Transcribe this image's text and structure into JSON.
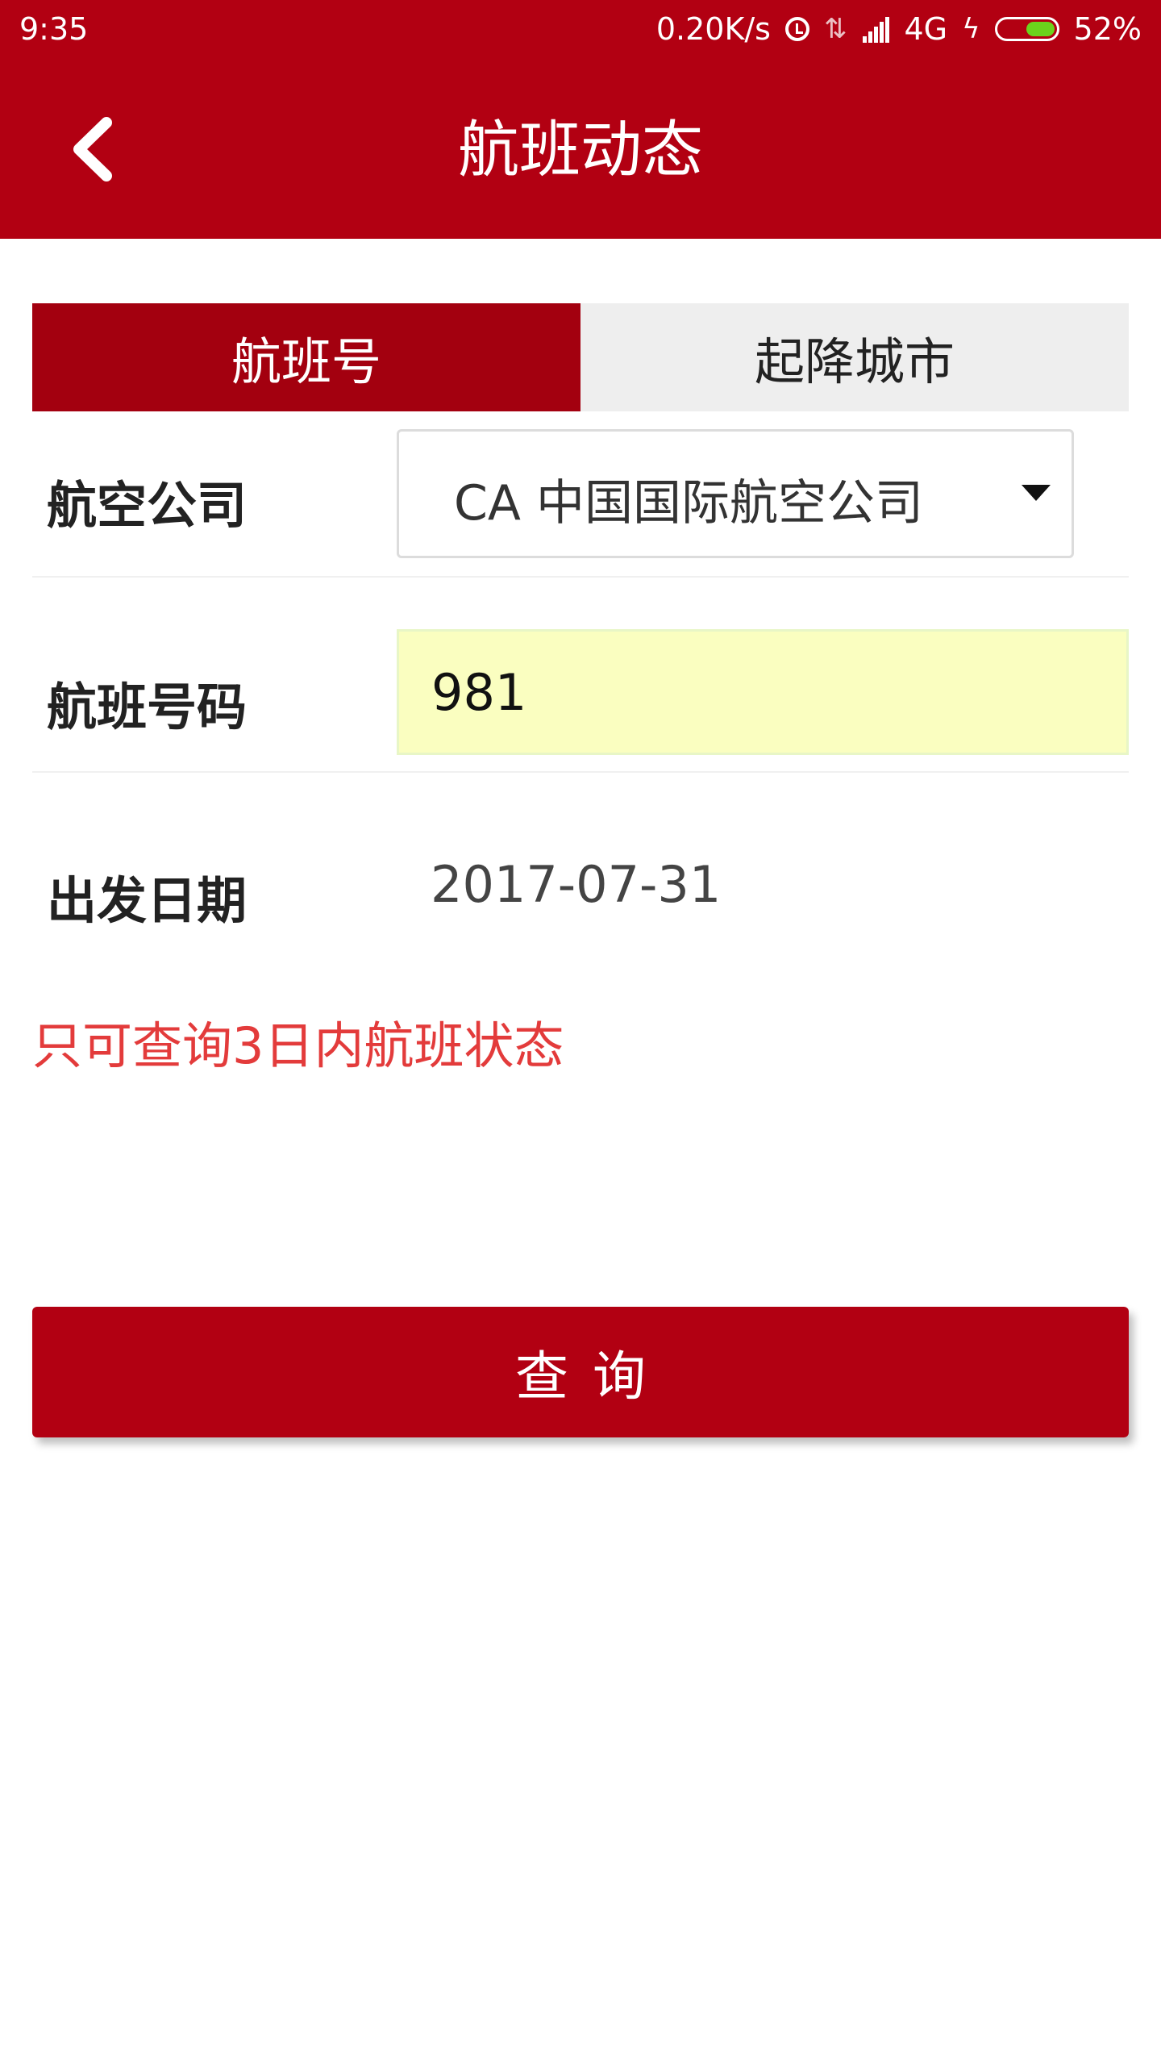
{
  "status_bar": {
    "time": "9:35",
    "net_speed": "0.20K/s",
    "network_type": "4G",
    "battery_percent": "52%",
    "battery_level": 0.52,
    "battery_fill_color": "#6bd31c"
  },
  "app_bar": {
    "title": "航班动态",
    "background_color": "#b20012"
  },
  "tabs": [
    {
      "label": "航班号",
      "active": true
    },
    {
      "label": "起降城市",
      "active": false
    }
  ],
  "form": {
    "airline": {
      "label": "航空公司",
      "selected_value": "CA 中国国际航空公司"
    },
    "flight_number": {
      "label": "航班号码",
      "value": "981"
    },
    "departure_date": {
      "label": "出发日期",
      "value": "2017-07-31"
    }
  },
  "notice": "只可查询3日内航班状态",
  "query_button_label": "查询",
  "colors": {
    "accent": "#b20012",
    "active_tab": "#a3000f",
    "notice_text": "#e33b3b",
    "input_highlight": "#fafec0"
  }
}
